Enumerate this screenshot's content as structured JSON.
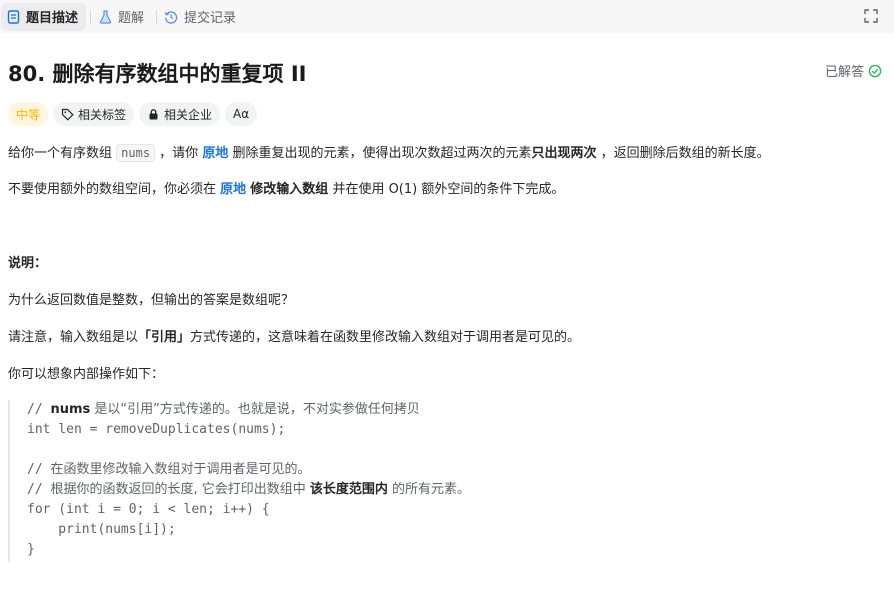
{
  "tabs": [
    {
      "label": "题目描述",
      "icon": "document-icon"
    },
    {
      "label": "题解",
      "icon": "flask-icon"
    },
    {
      "label": "提交记录",
      "icon": "history-icon"
    }
  ],
  "problem": {
    "title": "80. 删除有序数组中的重复项 II",
    "status": "已解答",
    "tags": {
      "difficulty": "中等",
      "topics": "相关标签",
      "companies": "相关企业",
      "font": "Aα"
    }
  },
  "desc": {
    "p1": {
      "a": "给你一个有序数组 ",
      "code": "nums",
      "b": " ，请你 ",
      "bold1": "原地",
      "c": " 删除重复出现的元素，使得出现次数超过两次的元素",
      "bold2": "只出现两次",
      "d": " ，返回删除后数组的新长度。"
    },
    "p2": {
      "a": "不要使用额外的数组空间，你必须在 ",
      "bold1": "原地",
      "b": " ",
      "bold2": "修改输入数组",
      "c": " 并在使用 O(1) 额外空间的条件下完成。"
    },
    "note_heading": "说明：",
    "q": "为什么返回数值是整数，但输出的答案是数组呢？",
    "p3": {
      "a": "请注意，输入数组是以",
      "bold": "「引用」",
      "b": "方式传递的，这意味着在函数里修改输入数组对于调用者是可见的。"
    },
    "p4": "你可以想象内部操作如下："
  },
  "code": {
    "l1a": "// ",
    "l1b": "nums",
    "l1c": " 是以“引用”方式传递的。也就是说，不对实参做任何拷贝",
    "l2": "int len = removeDuplicates(nums);",
    "l4a": "// ",
    "l4b": "在函数里修改输入数组对于调用者是可见的。",
    "l5a": "// ",
    "l5b": "根据你的函数返回的长度, 它会打印出数组中 ",
    "l5c": "该长度范围内",
    "l5d": " 的所有元素。",
    "l6": "for (int i = 0; i < len; i++) {",
    "l7": "    print(nums[i]);",
    "l8": "}"
  }
}
